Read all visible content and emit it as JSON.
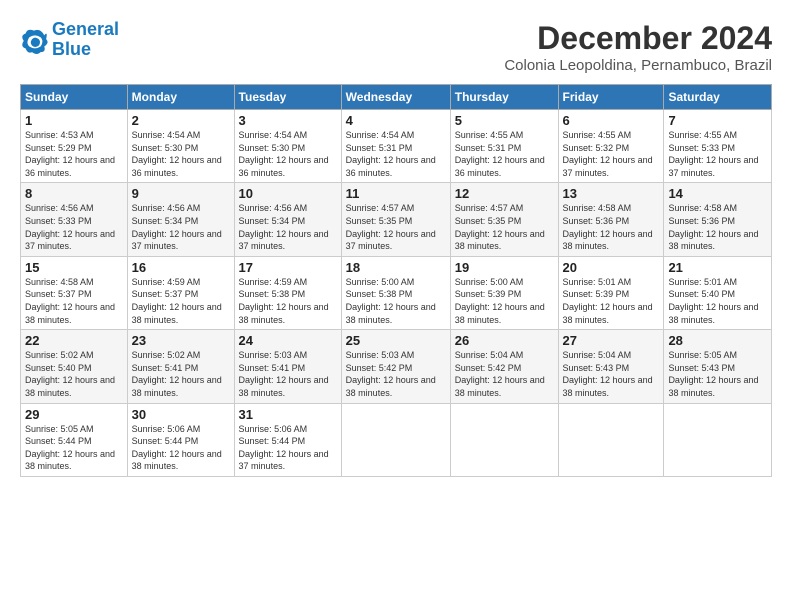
{
  "logo": {
    "line1": "General",
    "line2": "Blue"
  },
  "title": "December 2024",
  "subtitle": "Colonia Leopoldina, Pernambuco, Brazil",
  "headers": [
    "Sunday",
    "Monday",
    "Tuesday",
    "Wednesday",
    "Thursday",
    "Friday",
    "Saturday"
  ],
  "weeks": [
    [
      {
        "day": "1",
        "rise": "4:53 AM",
        "set": "5:29 PM",
        "daylight": "12 hours and 36 minutes."
      },
      {
        "day": "2",
        "rise": "4:54 AM",
        "set": "5:30 PM",
        "daylight": "12 hours and 36 minutes."
      },
      {
        "day": "3",
        "rise": "4:54 AM",
        "set": "5:30 PM",
        "daylight": "12 hours and 36 minutes."
      },
      {
        "day": "4",
        "rise": "4:54 AM",
        "set": "5:31 PM",
        "daylight": "12 hours and 36 minutes."
      },
      {
        "day": "5",
        "rise": "4:55 AM",
        "set": "5:31 PM",
        "daylight": "12 hours and 36 minutes."
      },
      {
        "day": "6",
        "rise": "4:55 AM",
        "set": "5:32 PM",
        "daylight": "12 hours and 37 minutes."
      },
      {
        "day": "7",
        "rise": "4:55 AM",
        "set": "5:33 PM",
        "daylight": "12 hours and 37 minutes."
      }
    ],
    [
      {
        "day": "8",
        "rise": "4:56 AM",
        "set": "5:33 PM",
        "daylight": "12 hours and 37 minutes."
      },
      {
        "day": "9",
        "rise": "4:56 AM",
        "set": "5:34 PM",
        "daylight": "12 hours and 37 minutes."
      },
      {
        "day": "10",
        "rise": "4:56 AM",
        "set": "5:34 PM",
        "daylight": "12 hours and 37 minutes."
      },
      {
        "day": "11",
        "rise": "4:57 AM",
        "set": "5:35 PM",
        "daylight": "12 hours and 37 minutes."
      },
      {
        "day": "12",
        "rise": "4:57 AM",
        "set": "5:35 PM",
        "daylight": "12 hours and 38 minutes."
      },
      {
        "day": "13",
        "rise": "4:58 AM",
        "set": "5:36 PM",
        "daylight": "12 hours and 38 minutes."
      },
      {
        "day": "14",
        "rise": "4:58 AM",
        "set": "5:36 PM",
        "daylight": "12 hours and 38 minutes."
      }
    ],
    [
      {
        "day": "15",
        "rise": "4:58 AM",
        "set": "5:37 PM",
        "daylight": "12 hours and 38 minutes."
      },
      {
        "day": "16",
        "rise": "4:59 AM",
        "set": "5:37 PM",
        "daylight": "12 hours and 38 minutes."
      },
      {
        "day": "17",
        "rise": "4:59 AM",
        "set": "5:38 PM",
        "daylight": "12 hours and 38 minutes."
      },
      {
        "day": "18",
        "rise": "5:00 AM",
        "set": "5:38 PM",
        "daylight": "12 hours and 38 minutes."
      },
      {
        "day": "19",
        "rise": "5:00 AM",
        "set": "5:39 PM",
        "daylight": "12 hours and 38 minutes."
      },
      {
        "day": "20",
        "rise": "5:01 AM",
        "set": "5:39 PM",
        "daylight": "12 hours and 38 minutes."
      },
      {
        "day": "21",
        "rise": "5:01 AM",
        "set": "5:40 PM",
        "daylight": "12 hours and 38 minutes."
      }
    ],
    [
      {
        "day": "22",
        "rise": "5:02 AM",
        "set": "5:40 PM",
        "daylight": "12 hours and 38 minutes."
      },
      {
        "day": "23",
        "rise": "5:02 AM",
        "set": "5:41 PM",
        "daylight": "12 hours and 38 minutes."
      },
      {
        "day": "24",
        "rise": "5:03 AM",
        "set": "5:41 PM",
        "daylight": "12 hours and 38 minutes."
      },
      {
        "day": "25",
        "rise": "5:03 AM",
        "set": "5:42 PM",
        "daylight": "12 hours and 38 minutes."
      },
      {
        "day": "26",
        "rise": "5:04 AM",
        "set": "5:42 PM",
        "daylight": "12 hours and 38 minutes."
      },
      {
        "day": "27",
        "rise": "5:04 AM",
        "set": "5:43 PM",
        "daylight": "12 hours and 38 minutes."
      },
      {
        "day": "28",
        "rise": "5:05 AM",
        "set": "5:43 PM",
        "daylight": "12 hours and 38 minutes."
      }
    ],
    [
      {
        "day": "29",
        "rise": "5:05 AM",
        "set": "5:44 PM",
        "daylight": "12 hours and 38 minutes."
      },
      {
        "day": "30",
        "rise": "5:06 AM",
        "set": "5:44 PM",
        "daylight": "12 hours and 38 minutes."
      },
      {
        "day": "31",
        "rise": "5:06 AM",
        "set": "5:44 PM",
        "daylight": "12 hours and 37 minutes."
      },
      null,
      null,
      null,
      null
    ]
  ]
}
